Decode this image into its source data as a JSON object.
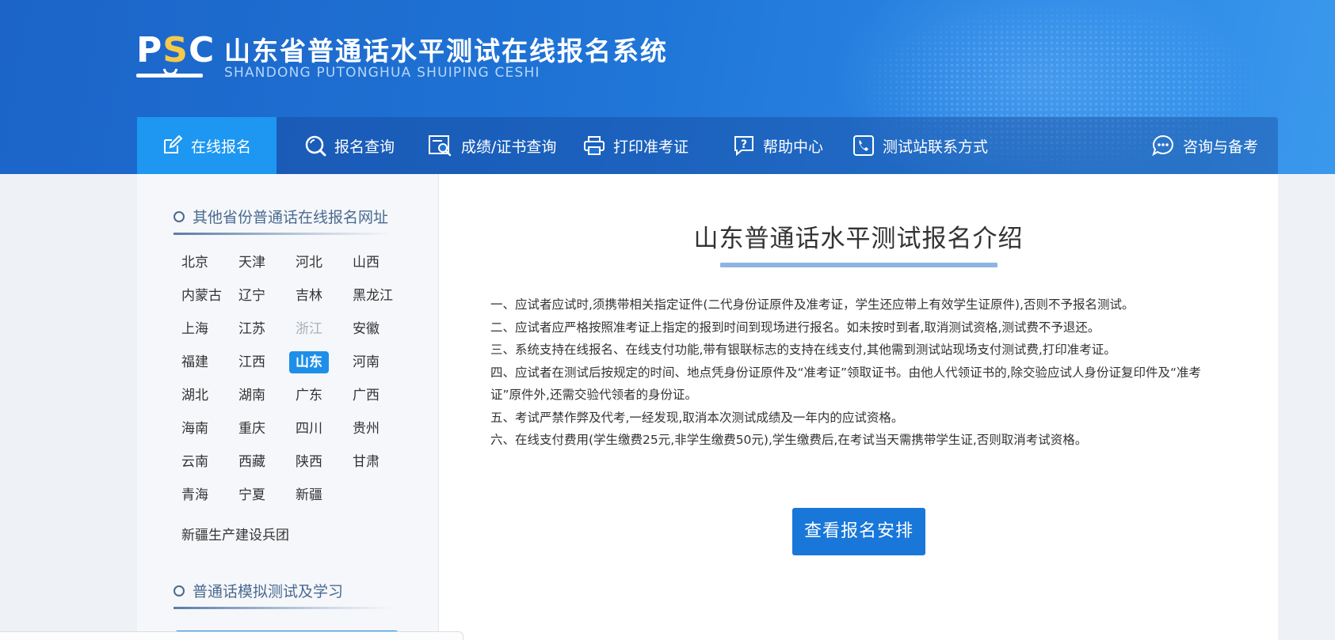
{
  "header": {
    "logo_text_p": "P",
    "logo_text_s": "S",
    "logo_text_c": "C",
    "title": "山东省普通话水平测试在线报名系统",
    "subtitle": "SHANDONG PUTONGHUA SHUIPING CESHI"
  },
  "nav": {
    "items": [
      {
        "label": "在线报名",
        "icon": "edit-icon",
        "active": true
      },
      {
        "label": "报名查询",
        "icon": "search-icon"
      },
      {
        "label": "成绩/证书查询",
        "icon": "certificate-search-icon"
      },
      {
        "label": "打印准考证",
        "icon": "printer-icon"
      },
      {
        "label": "帮助中心",
        "icon": "help-icon"
      },
      {
        "label": "测试站联系方式",
        "icon": "phone-icon"
      },
      {
        "label": "咨询与备考",
        "icon": "chat-icon"
      }
    ]
  },
  "sidebar": {
    "provinces_heading": "其他省份普通话在线报名网址",
    "provinces": [
      "北京",
      "天津",
      "河北",
      "山西",
      "内蒙古",
      "辽宁",
      "吉林",
      "黑龙江",
      "上海",
      "江苏",
      "浙江",
      "安徽",
      "福建",
      "江西",
      "山东",
      "河南",
      "湖北",
      "湖南",
      "广东",
      "广西",
      "海南",
      "重庆",
      "四川",
      "贵州",
      "云南",
      "西藏",
      "陕西",
      "甘肃",
      "青海",
      "宁夏",
      "新疆"
    ],
    "current_province": "山东",
    "disabled_province": "浙江",
    "extra_link": "新疆生产建设兵团",
    "practice_heading": "普通话模拟测试及学习"
  },
  "main": {
    "title": "山东普通话水平测试报名介绍",
    "rules": [
      "一、应试者应试时,须携带相关指定证件(二代身份证原件及准考证，学生还应带上有效学生证原件),否则不予报名测试。",
      "二、应试者应严格按照准考证上指定的报到时间到现场进行报名。如未按时到者,取消测试资格,测试费不予退还。",
      "三、系统支持在线报名、在线支付功能,带有银联标志的支持在线支付,其他需到测试站现场支付测试费,打印准考证。",
      "四、应试者在测试后按规定的时间、地点凭身份证原件及“准考证”领取证书。由他人代领证书的,除交验应试人身份证复印件及“准考证”原件外,还需交验代领者的身份证。",
      "五、考试严禁作弊及代考,一经发现,取消本次测试成绩及一年内的应试资格。",
      "六、在线支付费用(学生缴费25元,非学生缴费50元),学生缴费后,在考试当天需携带学生证,否则取消考试资格。"
    ],
    "button_label": "查看报名安排"
  },
  "colors": {
    "header_blue": "#1f74d6",
    "active_nav": "#1d97f2",
    "button_blue": "#1877d9",
    "logo_accent": "#f6c94a"
  }
}
